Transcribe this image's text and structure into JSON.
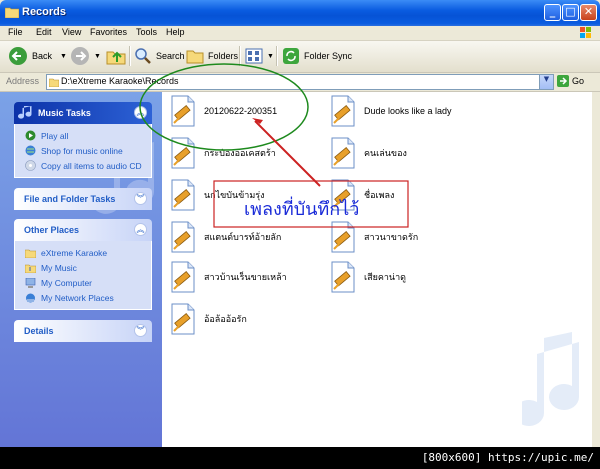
{
  "window": {
    "title": "Records"
  },
  "menu": [
    "File",
    "Edit",
    "View",
    "Favorites",
    "Tools",
    "Help"
  ],
  "toolbar": {
    "back": "Back",
    "search": "Search",
    "folders": "Folders",
    "folder_sync": "Folder Sync"
  },
  "address": {
    "label": "Address",
    "path": "D:\\eXtreme Karaoke\\Records",
    "go": "Go"
  },
  "music_tasks": {
    "title": "Music Tasks",
    "items": [
      "Play all",
      "Shop for music online",
      "Copy all items to audio CD"
    ]
  },
  "file_folder_tasks": {
    "title": "File and Folder Tasks"
  },
  "other_places": {
    "title": "Other Places",
    "items": [
      "eXtreme Karaoke",
      "My Music",
      "My Computer",
      "My Network Places"
    ]
  },
  "details": {
    "title": "Details"
  },
  "files": [
    "20120622-200351",
    "Dude looks like a lady",
    "กระป๋องออเคสตร้า",
    "คนเล่นของ",
    "นกไขบันข้ามรุ่ง",
    "ชื่อเพลง",
    "สแตนด์บารท์อ้ายลัก",
    "สาวนาขาดรัก",
    "สาวบ้านเร็นขายเหล้า",
    "เสียคาน่าดู",
    "อ้อล้ออ้อรัก"
  ],
  "annotation": {
    "text": "เพลงที่บันทึกไว้",
    "circle_color": "#1e8a1e",
    "arrow_color": "#cc2222"
  },
  "watermark": "[800x600] https://upic.me/"
}
